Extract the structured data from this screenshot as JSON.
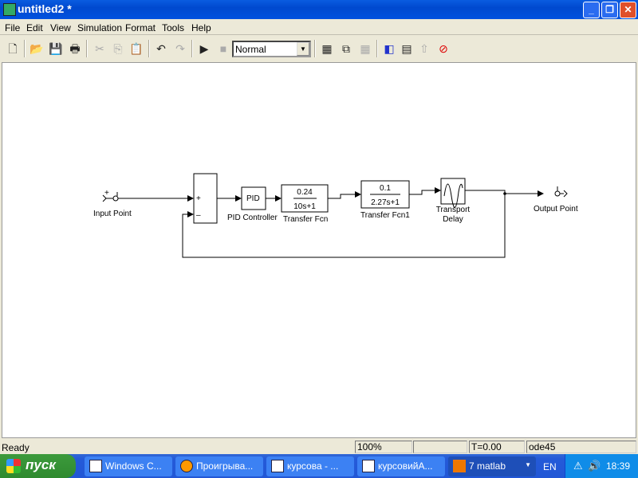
{
  "window": {
    "title": "untitled2 *"
  },
  "menu": [
    "File",
    "Edit",
    "View",
    "Simulation",
    "Format",
    "Tools",
    "Help"
  ],
  "toolbar": {
    "sim_mode": "Normal"
  },
  "diagram": {
    "input_point": "Input Point",
    "sum_signs": [
      "+",
      "–"
    ],
    "pid": {
      "text": "PID",
      "label": "PID Controller"
    },
    "tf": {
      "num": "0.24",
      "den": "10s+1",
      "label": "Transfer Fcn"
    },
    "tf1": {
      "num": "0.1",
      "den": "2.27s+1",
      "label": "Transfer Fcn1"
    },
    "delay": {
      "label1": "Transport",
      "label2": "Delay"
    },
    "output_point": "Output Point"
  },
  "status": {
    "text": "Ready",
    "zoom": "100%",
    "time": "T=0.00",
    "solver": "ode45"
  },
  "taskbar": {
    "start": "пуск",
    "tasks": [
      "Windows C...",
      "Проигрыва...",
      "курсова - ...",
      "курсовийА...",
      "7 matlab"
    ],
    "lang": "EN",
    "clock": "18:39"
  }
}
